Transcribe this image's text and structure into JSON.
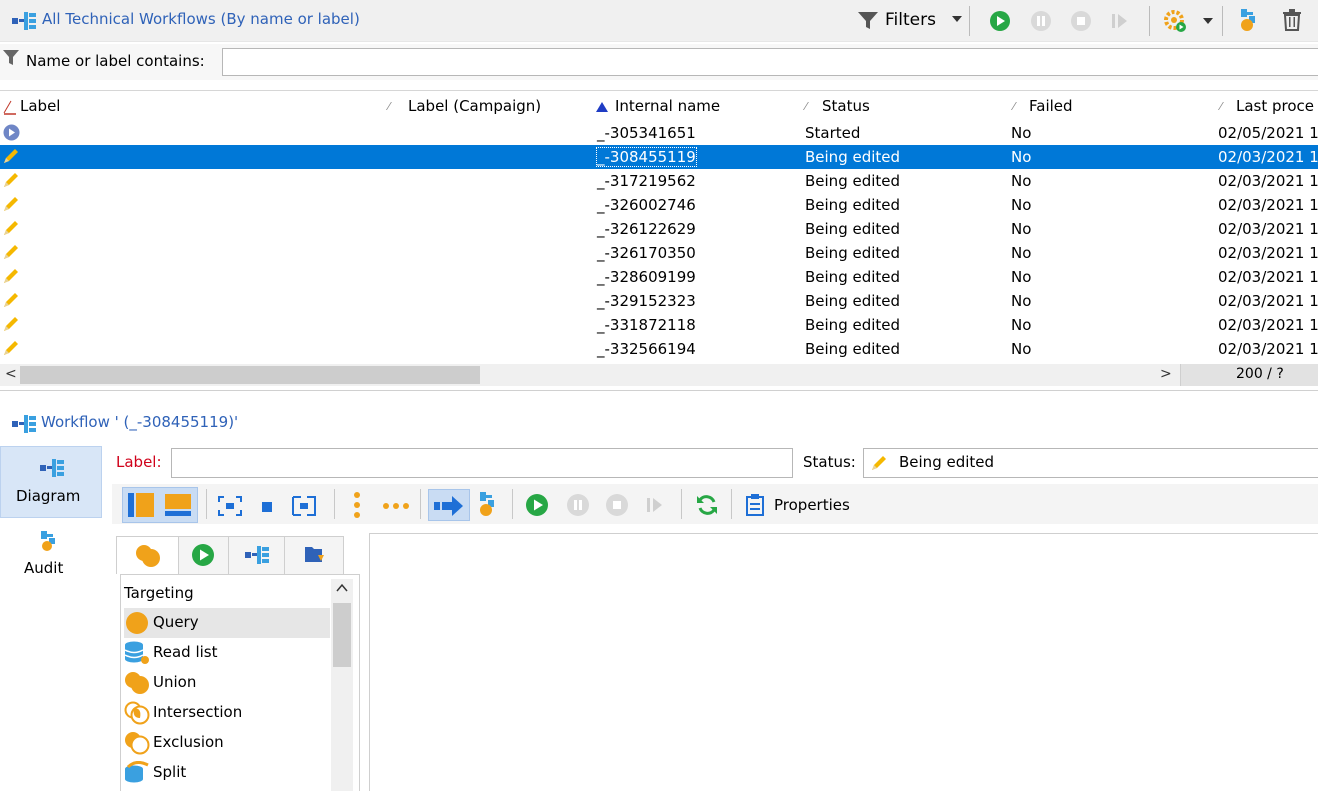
{
  "top": {
    "title": "All Technical Workflows (By name or label)",
    "filters_label": "Filters",
    "filter_label": "Name or label contains:",
    "filter_value": ""
  },
  "grid": {
    "columns": [
      "Label",
      "Label (Campaign)",
      "Internal name",
      "Status",
      "Failed",
      "Last proce"
    ],
    "rows": [
      {
        "icon": "started-icon",
        "internal": "_-305341651",
        "status": "Started",
        "failed": "No",
        "last": "02/05/2021 1"
      },
      {
        "icon": "pencil-icon",
        "internal": "_-308455119",
        "status": "Being edited",
        "failed": "No",
        "last": "02/03/2021 1"
      },
      {
        "icon": "pencil-icon",
        "internal": "_-317219562",
        "status": "Being edited",
        "failed": "No",
        "last": "02/03/2021 1"
      },
      {
        "icon": "pencil-icon",
        "internal": "_-326002746",
        "status": "Being edited",
        "failed": "No",
        "last": "02/03/2021 1"
      },
      {
        "icon": "pencil-icon",
        "internal": "_-326122629",
        "status": "Being edited",
        "failed": "No",
        "last": "02/03/2021 1"
      },
      {
        "icon": "pencil-icon",
        "internal": "_-326170350",
        "status": "Being edited",
        "failed": "No",
        "last": "02/03/2021 1"
      },
      {
        "icon": "pencil-icon",
        "internal": "_-328609199",
        "status": "Being edited",
        "failed": "No",
        "last": "02/03/2021 1"
      },
      {
        "icon": "pencil-icon",
        "internal": "_-329152323",
        "status": "Being edited",
        "failed": "No",
        "last": "02/03/2021 1"
      },
      {
        "icon": "pencil-icon",
        "internal": "_-331872118",
        "status": "Being edited",
        "failed": "No",
        "last": "02/03/2021 1"
      },
      {
        "icon": "pencil-icon",
        "internal": "_-332566194",
        "status": "Being edited",
        "failed": "No",
        "last": "02/03/2021 1"
      }
    ],
    "selected_row": 1,
    "page_count": "200 / ?"
  },
  "detail": {
    "title": "Workflow ' (_-308455119)'",
    "side": {
      "diagram": "Diagram",
      "audit": "Audit"
    },
    "label_caption": "Label:",
    "label_value": "",
    "status_caption": "Status:",
    "status_value": "Being edited",
    "properties_label": "Properties",
    "activities_header": "Targeting",
    "activities": [
      {
        "label": "Query",
        "icon": "query-icon"
      },
      {
        "label": "Read list",
        "icon": "read-list-icon"
      },
      {
        "label": "Union",
        "icon": "union-icon"
      },
      {
        "label": "Intersection",
        "icon": "intersection-icon"
      },
      {
        "label": "Exclusion",
        "icon": "exclusion-icon"
      },
      {
        "label": "Split",
        "icon": "split-icon"
      }
    ]
  },
  "colors": {
    "accent": "#0078d7",
    "orange": "#f0a21a",
    "green": "#27a745",
    "link": "#2f62b8",
    "pencil": "#f5b800"
  }
}
